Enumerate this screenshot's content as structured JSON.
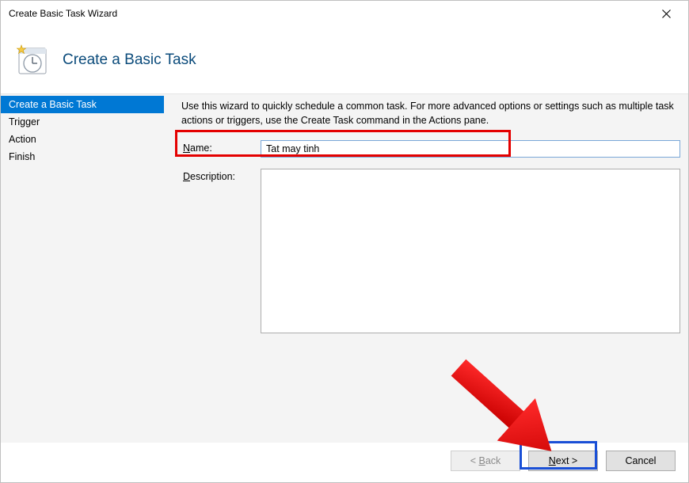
{
  "window": {
    "title": "Create Basic Task Wizard"
  },
  "header": {
    "title": "Create a Basic Task"
  },
  "sidebar": {
    "items": [
      {
        "label": "Create a Basic Task",
        "active": true
      },
      {
        "label": "Trigger",
        "active": false
      },
      {
        "label": "Action",
        "active": false
      },
      {
        "label": "Finish",
        "active": false
      }
    ]
  },
  "content": {
    "instructions": "Use this wizard to quickly schedule a common task.  For more advanced options or settings such as multiple task actions or triggers, use the Create Task command in the Actions pane.",
    "name_label": "Name:",
    "name_value": "Tat may tinh",
    "desc_label": "Description:"
  },
  "buttons": {
    "back": "< Back",
    "next": "Next >",
    "cancel": "Cancel"
  }
}
